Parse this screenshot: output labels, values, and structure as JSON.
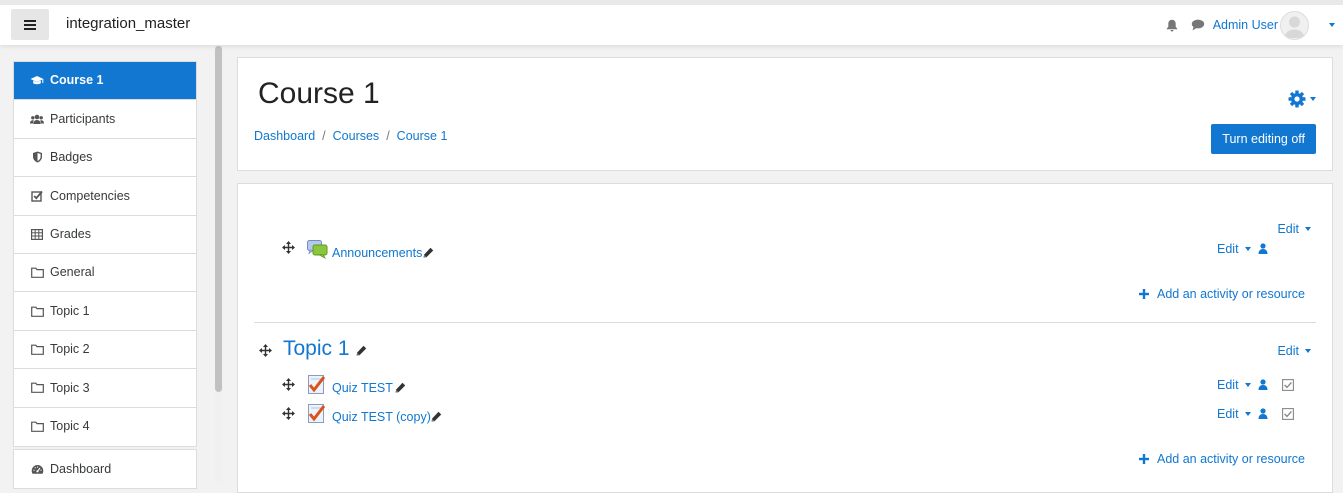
{
  "navbar": {
    "menu_icon": "hamburger-icon",
    "site_name": "integration_master",
    "notifications_icon": "bell-icon",
    "messages_icon": "chat-icon",
    "user_name": "Admin User",
    "avatar_icon": "user-avatar-icon"
  },
  "sidebar": {
    "course_items": [
      {
        "label": "Course 1",
        "icon": "graduation-cap-icon",
        "active": true
      },
      {
        "label": "Participants",
        "icon": "users-icon"
      },
      {
        "label": "Badges",
        "icon": "shield-icon"
      },
      {
        "label": "Competencies",
        "icon": "checkbox-icon"
      },
      {
        "label": "Grades",
        "icon": "table-icon"
      },
      {
        "label": "General",
        "icon": "folder-icon"
      },
      {
        "label": "Topic 1",
        "icon": "folder-icon"
      },
      {
        "label": "Topic 2",
        "icon": "folder-icon"
      },
      {
        "label": "Topic 3",
        "icon": "folder-icon"
      },
      {
        "label": "Topic 4",
        "icon": "folder-icon"
      }
    ],
    "site_items": [
      {
        "label": "Dashboard",
        "icon": "dashboard-icon"
      }
    ]
  },
  "header": {
    "title": "Course 1",
    "breadcrumb": [
      "Dashboard",
      "Courses",
      "Course 1"
    ],
    "settings_icon": "gear-icon",
    "turn_editing_label": "Turn editing off"
  },
  "sections": [
    {
      "name": "",
      "edit_label": "Edit",
      "activities": [
        {
          "name": "Announcements",
          "type_icon": "forum-icon",
          "edit_label": "Edit",
          "role_icon": "user-icon",
          "completion": false
        }
      ],
      "add_label": "Add an activity or resource"
    },
    {
      "name": "Topic 1",
      "edit_label": "Edit",
      "activities": [
        {
          "name": "Quiz TEST",
          "type_icon": "quiz-icon",
          "edit_label": "Edit",
          "role_icon": "user-icon",
          "completion": true
        },
        {
          "name": "Quiz TEST (copy)",
          "type_icon": "quiz-icon",
          "edit_label": "Edit",
          "role_icon": "user-icon",
          "completion": true
        }
      ],
      "add_label": "Add an activity or resource"
    }
  ],
  "colors": {
    "accent": "#1177d1",
    "background": "#f2f2f2",
    "forum_green": "#8cc63f"
  }
}
